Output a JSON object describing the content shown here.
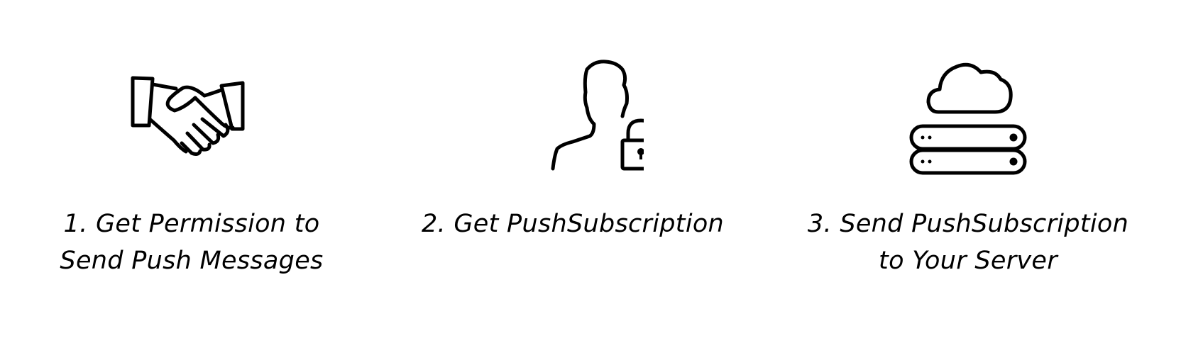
{
  "steps": [
    {
      "icon": "handshake-icon",
      "caption_lines": [
        "1. Get Permission to",
        "Send Push Messages"
      ]
    },
    {
      "icon": "user-lock-icon",
      "caption_lines": [
        "2. Get PushSubscription"
      ]
    },
    {
      "icon": "cloud-server-icon",
      "caption_lines": [
        "3. Send PushSubscription",
        "to Your Server"
      ]
    }
  ],
  "colors": {
    "background": "#ffffff",
    "stroke": "#000000"
  }
}
